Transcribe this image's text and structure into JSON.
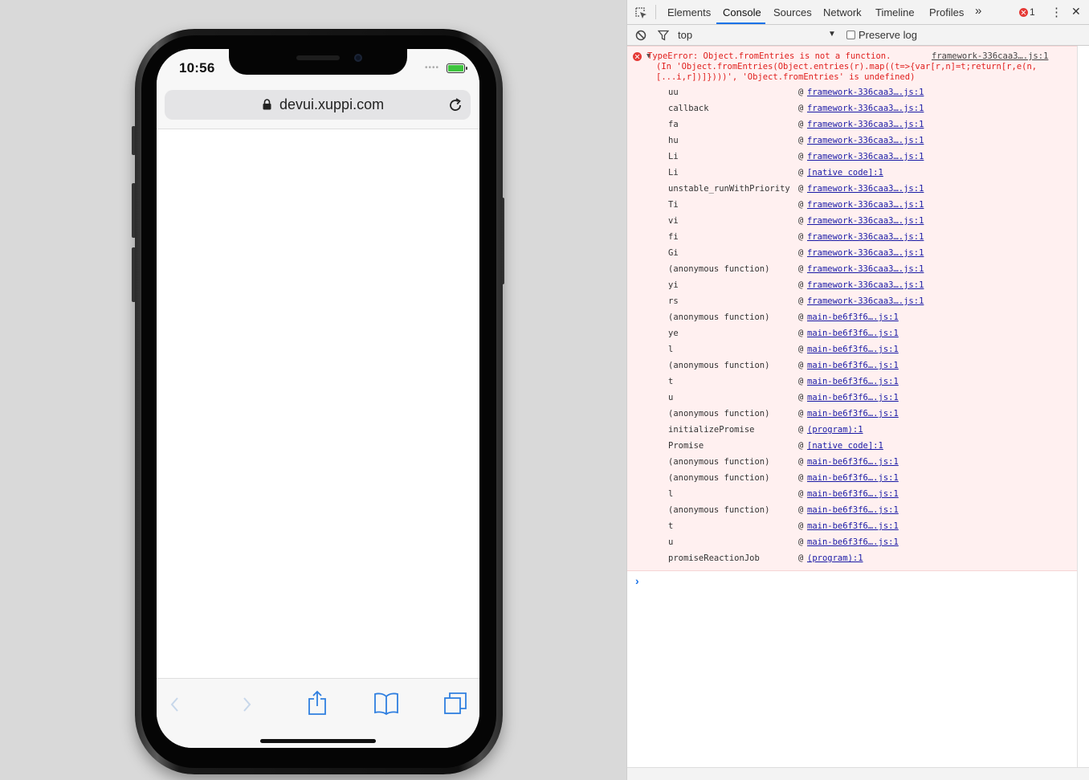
{
  "simulator": {
    "time": "10:56",
    "status_dots": "••••",
    "url": "devui.xuppi.com",
    "icons": {
      "lock": "lock-icon",
      "reload": "reload-icon",
      "back": "chevron-left-icon",
      "forward": "chevron-right-icon",
      "share": "share-icon",
      "bookmarks": "book-icon",
      "tabs": "tabs-icon"
    }
  },
  "devtools": {
    "tabs": [
      "Elements",
      "Console",
      "Sources",
      "Network",
      "Timeline",
      "Profiles"
    ],
    "active_tab": "Console",
    "more_tabs": "»",
    "error_count": "1",
    "menu": "⋮",
    "close": "✕",
    "context": "top",
    "preserve_log": "Preserve log",
    "error": {
      "message": "TypeError: Object.fromEntries is not a function.\n(In 'Object.fromEntries(Object.entries(r).map((t=>{var[r,n]=t;return[r,e(n,\n[...i,r])]})))', 'Object.fromEntries' is undefined)",
      "source": "framework-336caa3….js:1"
    },
    "frames": [
      {
        "fn": "uu",
        "loc": "framework-336caa3….js:1"
      },
      {
        "fn": "callback",
        "loc": "framework-336caa3….js:1"
      },
      {
        "fn": "fa",
        "loc": "framework-336caa3….js:1"
      },
      {
        "fn": "hu",
        "loc": "framework-336caa3….js:1"
      },
      {
        "fn": "Li",
        "loc": "framework-336caa3….js:1"
      },
      {
        "fn": "Li",
        "loc": "[native code]:1"
      },
      {
        "fn": "unstable_runWithPriority",
        "loc": "framework-336caa3….js:1"
      },
      {
        "fn": "Ti",
        "loc": "framework-336caa3….js:1"
      },
      {
        "fn": "vi",
        "loc": "framework-336caa3….js:1"
      },
      {
        "fn": "fi",
        "loc": "framework-336caa3….js:1"
      },
      {
        "fn": "Gi",
        "loc": "framework-336caa3….js:1"
      },
      {
        "fn": "(anonymous function)",
        "loc": "framework-336caa3….js:1"
      },
      {
        "fn": "yi",
        "loc": "framework-336caa3….js:1"
      },
      {
        "fn": "rs",
        "loc": "framework-336caa3….js:1"
      },
      {
        "fn": "(anonymous function)",
        "loc": "main-be6f3f6….js:1"
      },
      {
        "fn": "ye",
        "loc": "main-be6f3f6….js:1"
      },
      {
        "fn": "l",
        "loc": "main-be6f3f6….js:1"
      },
      {
        "fn": "(anonymous function)",
        "loc": "main-be6f3f6….js:1"
      },
      {
        "fn": "t",
        "loc": "main-be6f3f6….js:1"
      },
      {
        "fn": "u",
        "loc": "main-be6f3f6….js:1"
      },
      {
        "fn": "(anonymous function)",
        "loc": "main-be6f3f6….js:1"
      },
      {
        "fn": "initializePromise",
        "loc": "(program):1"
      },
      {
        "fn": "Promise",
        "loc": "[native code]:1"
      },
      {
        "fn": "(anonymous function)",
        "loc": "main-be6f3f6….js:1"
      },
      {
        "fn": "(anonymous function)",
        "loc": "main-be6f3f6….js:1"
      },
      {
        "fn": "l",
        "loc": "main-be6f3f6….js:1"
      },
      {
        "fn": "(anonymous function)",
        "loc": "main-be6f3f6….js:1"
      },
      {
        "fn": "t",
        "loc": "main-be6f3f6….js:1"
      },
      {
        "fn": "u",
        "loc": "main-be6f3f6….js:1"
      },
      {
        "fn": "promiseReactionJob",
        "loc": "(program):1"
      }
    ],
    "at_symbol": "@",
    "prompt": "›"
  }
}
